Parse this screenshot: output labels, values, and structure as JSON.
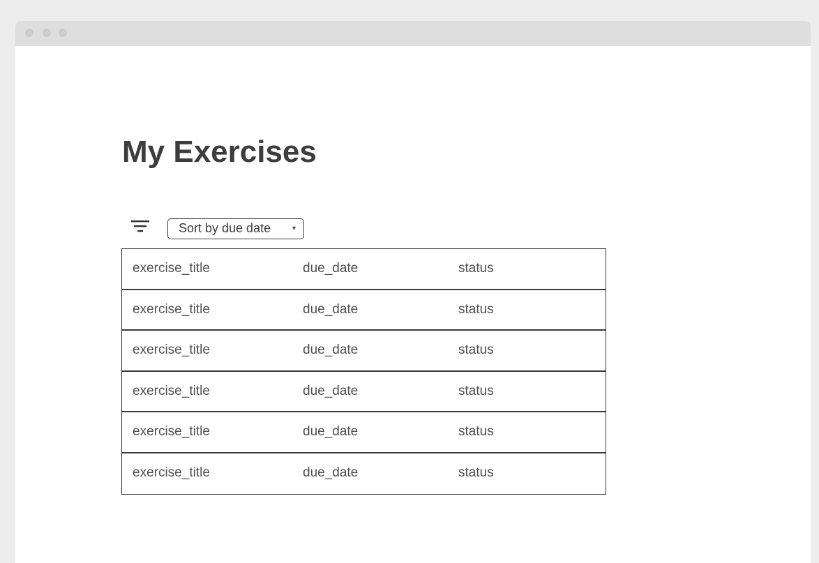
{
  "window": {
    "controls": [
      "close-dot",
      "minimize-dot",
      "zoom-dot"
    ]
  },
  "page": {
    "title": "My Exercises"
  },
  "toolbar": {
    "filter_icon": "filter-icon",
    "sort_label": "Sort by due date",
    "sort_caret": "▾"
  },
  "table": {
    "rows": [
      {
        "title": "exercise_title",
        "due_date": "due_date",
        "status": "status"
      },
      {
        "title": "exercise_title",
        "due_date": "due_date",
        "status": "status"
      },
      {
        "title": "exercise_title",
        "due_date": "due_date",
        "status": "status"
      },
      {
        "title": "exercise_title",
        "due_date": "due_date",
        "status": "status"
      },
      {
        "title": "exercise_title",
        "due_date": "due_date",
        "status": "status"
      },
      {
        "title": "exercise_title",
        "due_date": "due_date",
        "status": "status"
      }
    ]
  },
  "colors": {
    "background": "#ededed",
    "window": "#ffffff",
    "titlebar": "#dedede",
    "text": "#3d3d3d",
    "border": "#333333"
  }
}
